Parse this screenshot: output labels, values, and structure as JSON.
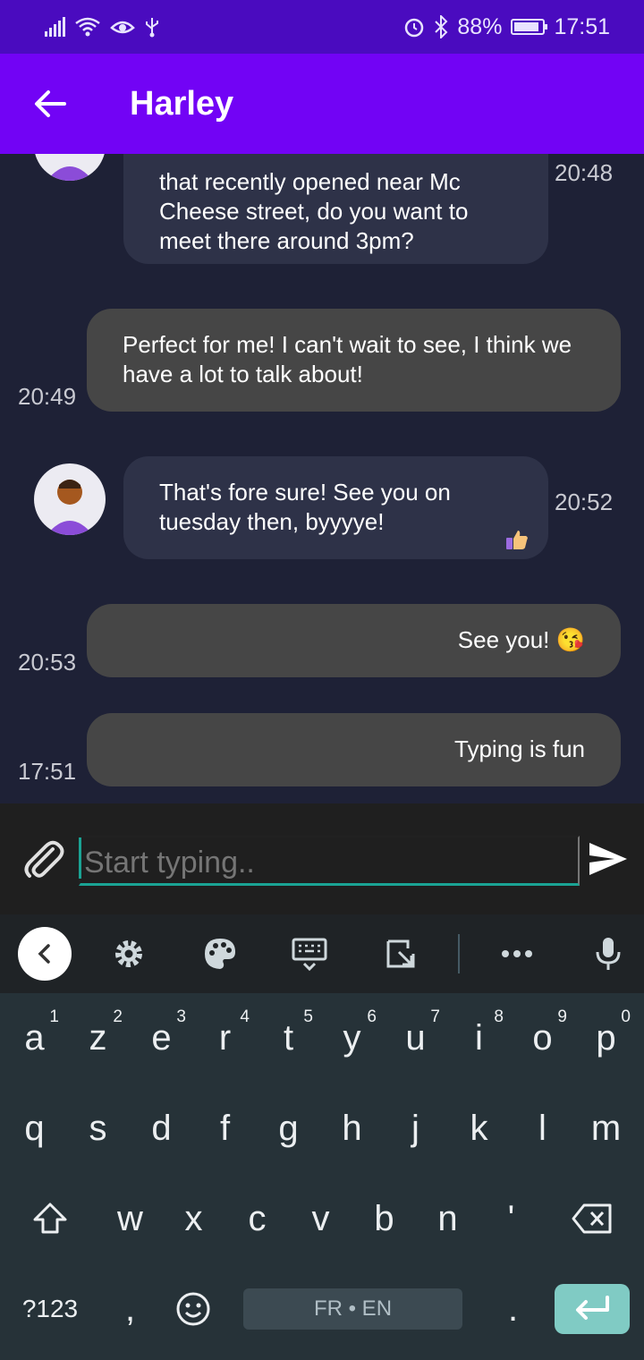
{
  "status_bar": {
    "battery": "88%",
    "time": "17:51",
    "battery_level": 0.88
  },
  "app_bar": {
    "title": "Harley"
  },
  "messages": [
    {
      "sender": "contact",
      "text": "that recently opened near Mc Cheese street, do you want to meet there around 3pm?",
      "time": "20:48"
    },
    {
      "sender": "me",
      "text": "Perfect for me! I can't wait to see, I think we have a lot to talk about!",
      "time": "20:49"
    },
    {
      "sender": "contact",
      "text": "That's fore sure! See you on tuesday then, byyyye!",
      "time": "20:52",
      "reaction": "thumbs-up"
    },
    {
      "sender": "me",
      "text": "See you! 😘",
      "time": "20:53"
    },
    {
      "sender": "me",
      "text": "Typing is fun",
      "time": "17:51"
    }
  ],
  "composer": {
    "placeholder": "Start typing..",
    "value": ""
  },
  "keyboard": {
    "row1": [
      {
        "key": "a",
        "hint": "1"
      },
      {
        "key": "z",
        "hint": "2"
      },
      {
        "key": "e",
        "hint": "3"
      },
      {
        "key": "r",
        "hint": "4"
      },
      {
        "key": "t",
        "hint": "5"
      },
      {
        "key": "y",
        "hint": "6"
      },
      {
        "key": "u",
        "hint": "7"
      },
      {
        "key": "i",
        "hint": "8"
      },
      {
        "key": "o",
        "hint": "9"
      },
      {
        "key": "p",
        "hint": "0"
      }
    ],
    "row2": [
      "q",
      "s",
      "d",
      "f",
      "g",
      "h",
      "j",
      "k",
      "l",
      "m"
    ],
    "row3": [
      "w",
      "x",
      "c",
      "v",
      "b",
      "n",
      "'"
    ],
    "symbols_key": "?123",
    "comma_key": ",",
    "period_key": ".",
    "space_label": "FR • EN"
  },
  "colors": {
    "status_bar": "#4a0bbf",
    "app_bar": "#7203f5",
    "chat_bg": "#1e2136",
    "bubble_in": "#2e3248",
    "bubble_out": "#464646",
    "accent": "#1aa394",
    "enter_key": "#80cbc4"
  }
}
